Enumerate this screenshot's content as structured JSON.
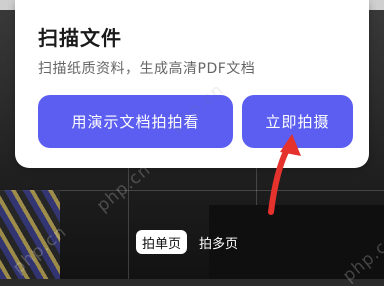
{
  "dialog": {
    "title": "扫描文件",
    "subtitle": "扫描纸质资料，生成高清PDF文档",
    "demo_button_label": "用演示文档拍拍看",
    "shoot_button_label": "立即拍摄"
  },
  "capture_modes": {
    "items": [
      {
        "label": "拍单页",
        "selected": true
      },
      {
        "label": "拍多页",
        "selected": false
      }
    ]
  },
  "watermark_text": "php.cn",
  "colors": {
    "accent": "#5b5ef0",
    "arrow": "#e5322d",
    "dialog_bg": "#ffffff"
  }
}
